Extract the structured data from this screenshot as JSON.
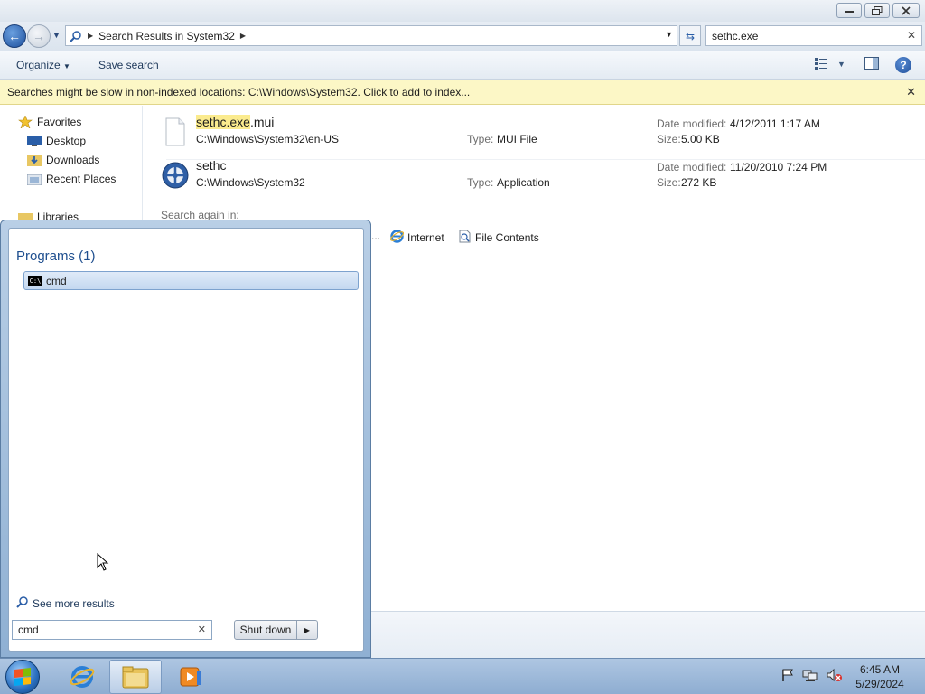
{
  "explorer": {
    "address": {
      "path_label": "Search Results in System32"
    },
    "search": {
      "value": "sethc.exe"
    },
    "toolbar": {
      "organize_label": "Organize",
      "save_search_label": "Save search"
    },
    "infobar": {
      "message": "Searches might be slow in non-indexed locations: C:\\Windows\\System32. Click to add to index..."
    },
    "navpane": {
      "favorites_label": "Favorites",
      "items": [
        "Desktop",
        "Downloads",
        "Recent Places"
      ],
      "libraries_label": "Libraries"
    },
    "results": [
      {
        "name_highlight": "sethc.exe",
        "name_rest": ".mui",
        "path": "C:\\Windows\\System32\\en-US",
        "type_label": "Type:",
        "type": "MUI File",
        "date_label": "Date modified:",
        "date": "4/12/2011 1:17 AM",
        "size_label": "Size:",
        "size": "5.00 KB"
      },
      {
        "name_highlight": "",
        "name_rest": "sethc",
        "path": "C:\\Windows\\System32",
        "type_label": "Type:",
        "type": "Application",
        "date_label": "Date modified:",
        "date": "11/20/2010 7:24 PM",
        "size_label": "Size:",
        "size": "272 KB"
      }
    ],
    "search_again": {
      "label": "Search again in:",
      "ellipsis": "...",
      "internet_label": "Internet",
      "file_contents_label": "File Contents"
    }
  },
  "start_menu": {
    "group_label": "Programs (1)",
    "result_label": "cmd",
    "see_more_label": "See more results",
    "search_value": "cmd",
    "shutdown_label": "Shut down"
  },
  "taskbar": {
    "time": "6:45 AM",
    "date": "5/29/2024"
  }
}
